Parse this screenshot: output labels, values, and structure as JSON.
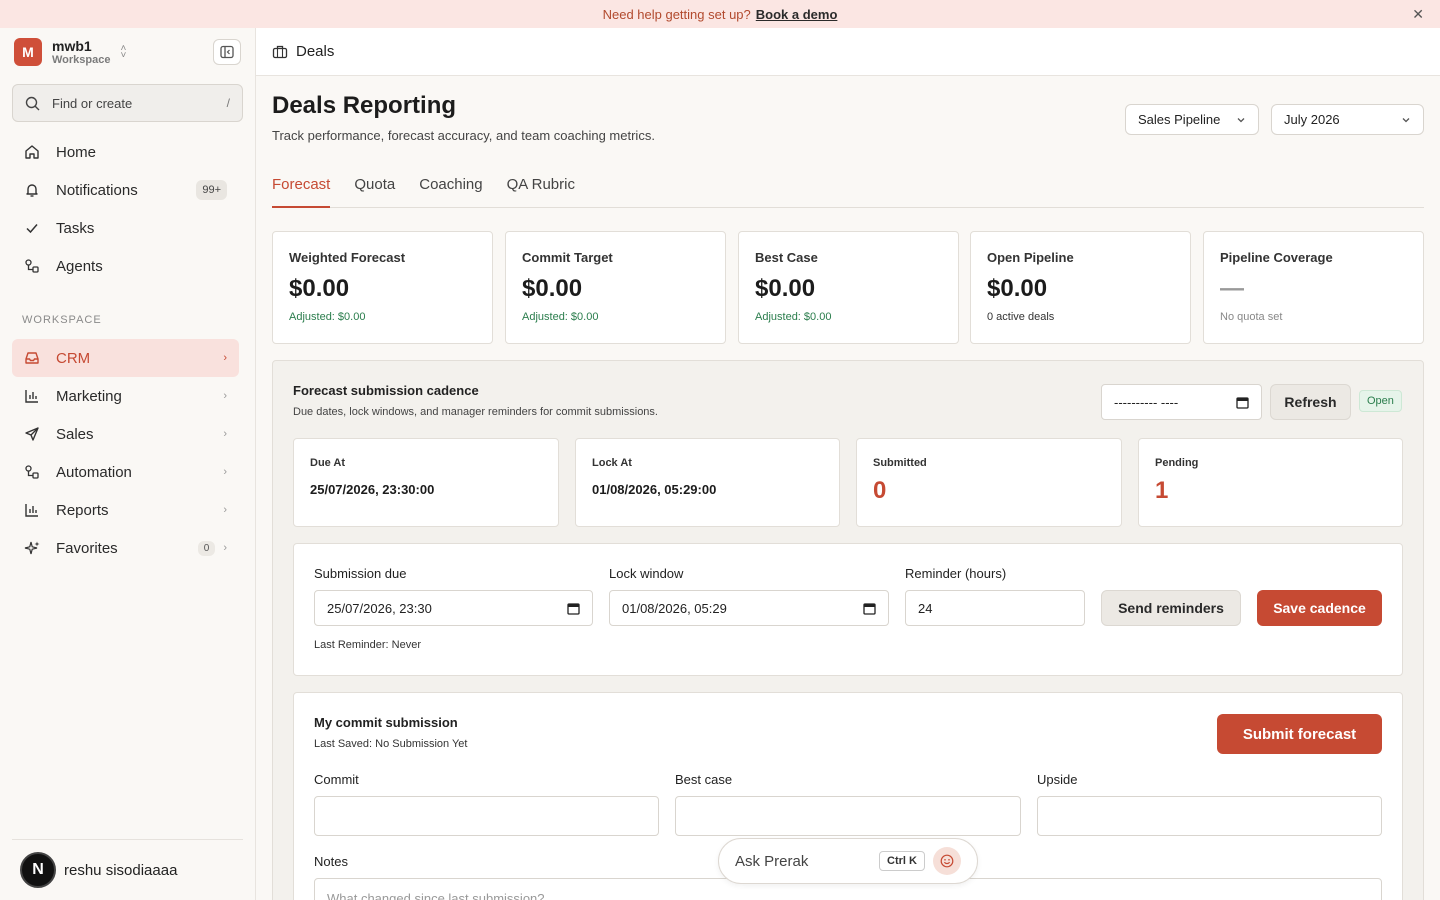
{
  "banner": {
    "text": "Need help getting set up?",
    "link": "Book a demo"
  },
  "workspace": {
    "avatar": "M",
    "name": "mwb1",
    "sub": "Workspace"
  },
  "search": {
    "placeholder": "Find or create",
    "shortcut": "/"
  },
  "nav": {
    "home": "Home",
    "notifications": "Notifications",
    "notifications_badge": "99+",
    "tasks": "Tasks",
    "agents": "Agents"
  },
  "section_label": "WORKSPACE",
  "workspace_nav": {
    "crm": "CRM",
    "marketing": "Marketing",
    "sales": "Sales",
    "automation": "Automation",
    "reports": "Reports",
    "favorites": "Favorites",
    "favorites_count": "0"
  },
  "user": {
    "avatar": "N",
    "name": "reshu sisodiaaaa"
  },
  "topbar": {
    "title": "Deals"
  },
  "page": {
    "title": "Deals Reporting",
    "subtitle": "Track performance, forecast accuracy, and team coaching metrics.",
    "pipeline_select": "Sales Pipeline",
    "period_select": "July 2026"
  },
  "tabs": [
    "Forecast",
    "Quota",
    "Coaching",
    "QA Rubric"
  ],
  "kpis": [
    {
      "label": "Weighted Forecast",
      "value": "$0.00",
      "note": "Adjusted: $0.00"
    },
    {
      "label": "Commit Target",
      "value": "$0.00",
      "note": "Adjusted: $0.00"
    },
    {
      "label": "Best Case",
      "value": "$0.00",
      "note": "Adjusted: $0.00"
    },
    {
      "label": "Open Pipeline",
      "value": "$0.00",
      "note": "0 active deals"
    },
    {
      "label": "Pipeline Coverage",
      "value": "—",
      "note": "No quota set"
    }
  ],
  "cadence": {
    "title": "Forecast submission cadence",
    "subtitle": "Due dates, lock windows, and manager reminders for commit submissions.",
    "date_value": "---------- ----",
    "refresh": "Refresh",
    "status": "Open",
    "stats": [
      {
        "label": "Due At",
        "value": "25/07/2026, 23:30:00"
      },
      {
        "label": "Lock At",
        "value": "01/08/2026, 05:29:00"
      },
      {
        "label": "Submitted",
        "value": "0"
      },
      {
        "label": "Pending",
        "value": "1"
      }
    ],
    "form": {
      "due_label": "Submission due",
      "due_value": "25/07/2026, 23:30",
      "lock_label": "Lock window",
      "lock_value": "01/08/2026, 05:29",
      "reminder_label": "Reminder (hours)",
      "reminder_value": "24",
      "send": "Send reminders",
      "save": "Save cadence",
      "last_reminder": "Last Reminder: Never"
    }
  },
  "submission": {
    "title": "My commit submission",
    "last_saved": "Last Saved: No Submission Yet",
    "submit": "Submit forecast",
    "commit_label": "Commit",
    "best_label": "Best case",
    "upside_label": "Upside",
    "notes_label": "Notes",
    "notes_placeholder": "What changed since last submission?"
  },
  "ask": {
    "text": "Ask Prerak",
    "shortcut": "Ctrl K"
  }
}
